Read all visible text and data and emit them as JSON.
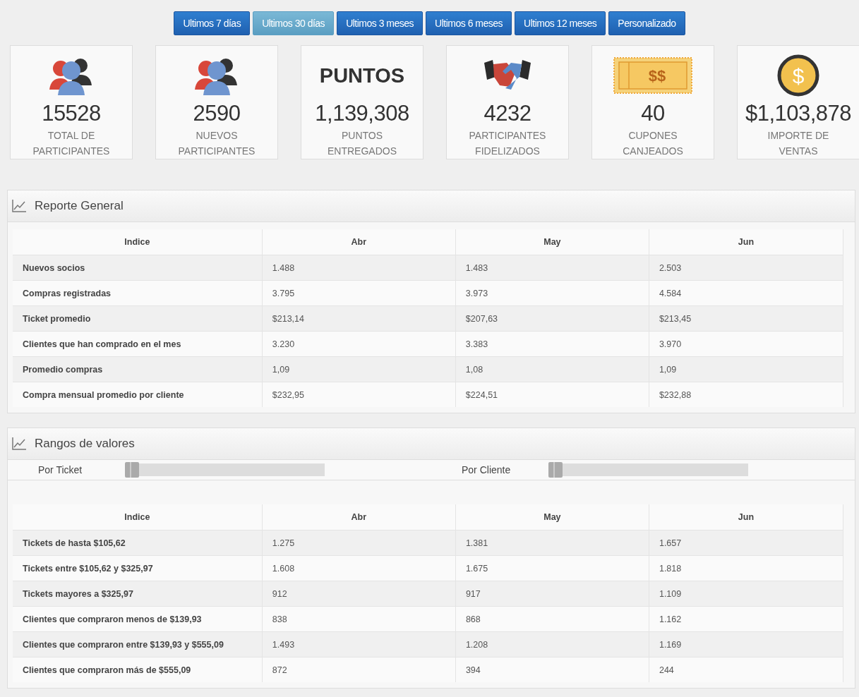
{
  "range_buttons": [
    {
      "label": "Ultimos 7 días",
      "selected": false
    },
    {
      "label": "Ultimos 30 días",
      "selected": true
    },
    {
      "label": "Ultimos 3 meses",
      "selected": false
    },
    {
      "label": "Ultimos 6 meses",
      "selected": false
    },
    {
      "label": "Ultimos 12 meses",
      "selected": false
    },
    {
      "label": "Personalizado",
      "selected": false
    }
  ],
  "stats": [
    {
      "kind": "people",
      "value": "15528",
      "label": "TOTAL DE PARTICIPANTES"
    },
    {
      "kind": "people",
      "value": "2590",
      "label": "NUEVOS PARTICIPANTES"
    },
    {
      "kind": "word",
      "icon_text": "PUNTOS",
      "value": "1,139,308",
      "label": "PUNTOS ENTREGADOS"
    },
    {
      "kind": "handshake",
      "value": "4232",
      "label": "PARTICIPANTES FIDELIZADOS"
    },
    {
      "kind": "coupon",
      "icon_text": "$$",
      "value": "40",
      "label": "CUPONES CANJEADOS"
    },
    {
      "kind": "coin",
      "icon_text": "$",
      "value": "$1,103,878",
      "label": "IMPORTE DE VENTAS"
    }
  ],
  "panels": [
    {
      "title": "Reporte General",
      "table": {
        "columns": [
          "Indice",
          "Abr",
          "May",
          "Jun"
        ],
        "rows": [
          [
            "Nuevos socios",
            "1.488",
            "1.483",
            "2.503"
          ],
          [
            "Compras registradas",
            "3.795",
            "3.973",
            "4.584"
          ],
          [
            "Ticket promedio",
            "$213,14",
            "$207,63",
            "$213,45"
          ],
          [
            "Clientes que han comprado en el mes",
            "3.230",
            "3.383",
            "3.970"
          ],
          [
            "Promedio compras",
            "1,09",
            "1,08",
            "1,09"
          ],
          [
            "Compra mensual promedio por cliente",
            "$232,95",
            "$224,51",
            "$232,88"
          ]
        ]
      }
    },
    {
      "title": "Rangos de valores",
      "sliders": [
        {
          "label": "Por Ticket",
          "level": 0
        },
        {
          "label": "Por Cliente",
          "level": 0
        }
      ],
      "table": {
        "columns": [
          "Indice",
          "Abr",
          "May",
          "Jun"
        ],
        "rows": [
          [
            "Tickets de hasta $105,62",
            "1.275",
            "1.381",
            "1.657"
          ],
          [
            "Tickets entre $105,62 y $325,97",
            "1.608",
            "1.675",
            "1.818"
          ],
          [
            "Tickets mayores a $325,97",
            "912",
            "917",
            "1.109"
          ],
          [
            "Clientes que compraron menos de $139,93",
            "838",
            "868",
            "1.162"
          ],
          [
            "Clientes que compraron entre $139,93 y $555,09",
            "1.493",
            "1.208",
            "1.169"
          ],
          [
            "Clientes que compraron más de $555,09",
            "872",
            "394",
            "244"
          ]
        ]
      }
    }
  ]
}
